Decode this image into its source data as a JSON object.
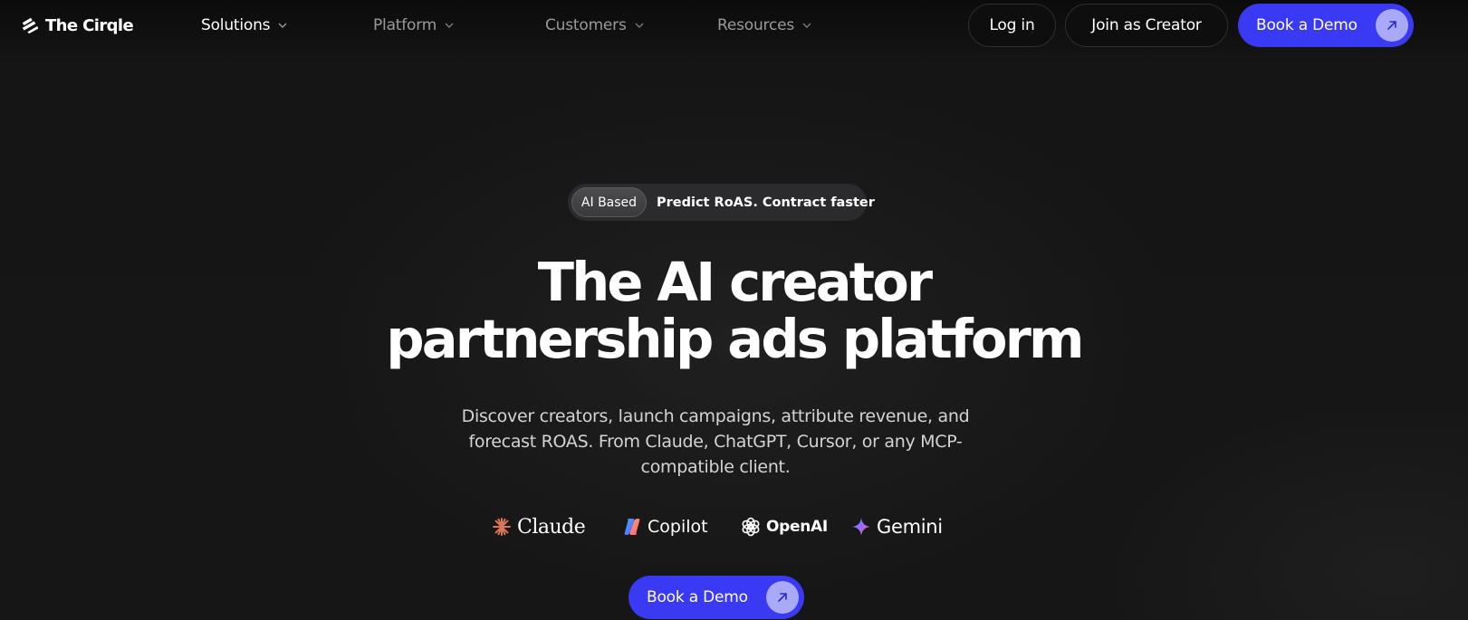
{
  "brand": {
    "name": "The Cirqle"
  },
  "nav": {
    "items": [
      {
        "label": "Solutions"
      },
      {
        "label": "Platform"
      },
      {
        "label": "Customers"
      },
      {
        "label": "Resources"
      }
    ],
    "login_label": "Log in",
    "join_label": "Join as Creator",
    "demo_label": "Book a Demo"
  },
  "hero": {
    "badge_pill": "AI Based",
    "badge_text": "Predict RoAS. Contract faster",
    "headline_line1": "The AI creator",
    "headline_line2": "partnership ads platform",
    "subtitle": "Discover creators, launch campaigns, attribute revenue, and forecast ROAS. From Claude, ChatGPT, Cursor, or any MCP-compatible client.",
    "integrations": [
      {
        "name": "Claude",
        "icon": "claude-icon"
      },
      {
        "name": "Copilot",
        "icon": "copilot-icon"
      },
      {
        "name": "OpenAI",
        "icon": "openai-icon"
      },
      {
        "name": "Gemini",
        "icon": "gemini-icon"
      }
    ],
    "cta_label": "Book a Demo"
  },
  "colors": {
    "background": "#121212",
    "accent": "#3a3af4",
    "accent_light": "#a9a9f8",
    "muted_text": "#9a9a9a",
    "claude_orange": "#d97757"
  }
}
